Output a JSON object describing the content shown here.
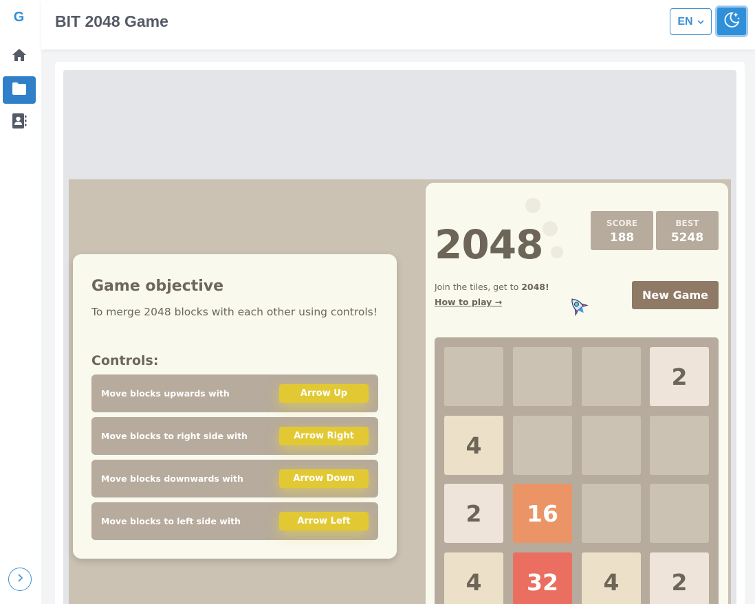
{
  "app": {
    "logo": "G",
    "title": "BIT 2048 Game"
  },
  "sidebar": {
    "items": [
      {
        "icon": "home-icon",
        "active": false
      },
      {
        "icon": "folder-icon",
        "active": true
      },
      {
        "icon": "contacts-icon",
        "active": false
      }
    ],
    "expand_icon": "chevron-right-icon"
  },
  "header": {
    "language": "EN",
    "theme_icon": "moon-stars-icon"
  },
  "objective": {
    "title": "Game objective",
    "description": "To merge 2048 blocks with each other using controls!",
    "controls_title": "Controls:",
    "controls": [
      {
        "label": "Move blocks upwards with",
        "key": "Arrow Up"
      },
      {
        "label": "Move blocks to right side with",
        "key": "Arrow Right"
      },
      {
        "label": "Move blocks downwards with",
        "key": "Arrow Down"
      },
      {
        "label": "Move blocks to left side with",
        "key": "Arrow Left"
      }
    ]
  },
  "game": {
    "title": "2048",
    "score": {
      "label": "SCORE",
      "value": "188"
    },
    "best": {
      "label": "BEST",
      "value": "5248"
    },
    "intro_prefix": "Join the tiles, get to ",
    "intro_target": "2048!",
    "how_to_play": "How to play →",
    "new_game": "New Game",
    "board": [
      [
        "",
        "",
        "",
        "2"
      ],
      [
        "4",
        "",
        "",
        ""
      ],
      [
        "2",
        "16",
        "",
        ""
      ],
      [
        "4",
        "32",
        "4",
        "2"
      ]
    ]
  },
  "colors": {
    "accent": "#2f8fd8",
    "board": "#b6ab9c",
    "empty_cell": "#cbc2b3",
    "tile_2": "#eee4da",
    "tile_4": "#ede0c8",
    "tile_16": "#eb9566",
    "tile_32": "#ea6f61",
    "key_yellow": "#e2c934",
    "button_brown": "#8f7a66"
  }
}
